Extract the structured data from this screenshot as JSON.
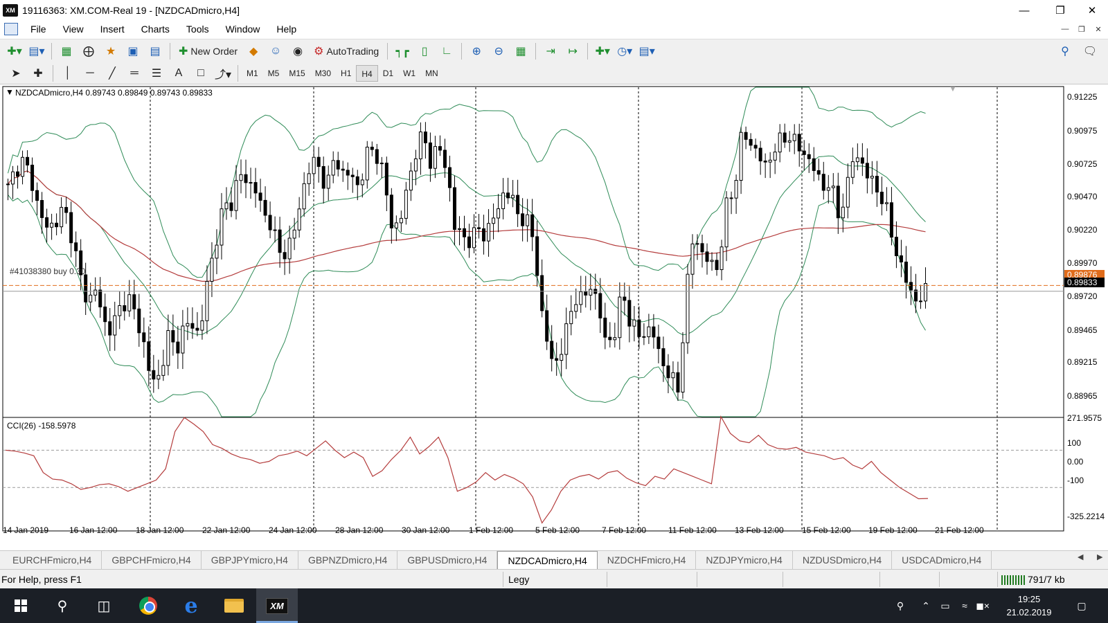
{
  "window": {
    "title": "19116363: XM.COM-Real 19 - [NZDCADmicro,H4]",
    "logo": "XM"
  },
  "menu": [
    "File",
    "View",
    "Insert",
    "Charts",
    "Tools",
    "Window",
    "Help"
  ],
  "toolbar": {
    "new_order": "New Order",
    "autotrading": "AutoTrading"
  },
  "timeframes": [
    "M1",
    "M5",
    "M15",
    "M30",
    "H1",
    "H4",
    "D1",
    "W1",
    "MN"
  ],
  "active_timeframe": "H4",
  "chart": {
    "header": "NZDCADmicro,H4  0.89743 0.89849 0.89743 0.89833",
    "order_label": "#41038380 buy 0.30",
    "current_price": "0.89833",
    "bid_price": "0.89876",
    "price_ticks": [
      "0.91225",
      "0.90975",
      "0.90725",
      "0.90470",
      "0.90220",
      "0.89970",
      "0.89720",
      "0.89465",
      "0.89215",
      "0.88965"
    ],
    "cci_label": "CCI(26) -158.5978",
    "cci_ticks": [
      "271.9575",
      "100",
      "0.00",
      "-100",
      "-325.2214"
    ],
    "time_labels": [
      "14 Jan 2019",
      "16 Jan 12:00",
      "18 Jan 12:00",
      "22 Jan 12:00",
      "24 Jan 12:00",
      "28 Jan 12:00",
      "30 Jan 12:00",
      "1 Feb 12:00",
      "5 Feb 12:00",
      "7 Feb 12:00",
      "11 Feb 12:00",
      "13 Feb 12:00",
      "15 Feb 12:00",
      "19 Feb 12:00",
      "21 Feb 12:00"
    ]
  },
  "chart_data": {
    "type": "candlestick",
    "symbol": "NZDCADmicro",
    "timeframe": "H4",
    "ylim": [
      0.889,
      0.9135
    ],
    "order_level": 0.89876,
    "current_level": 0.89833,
    "close_path": [
      0.906,
      0.9075,
      0.908,
      0.9065,
      0.904,
      0.903,
      0.9035,
      0.9045,
      0.9025,
      0.8995,
      0.8975,
      0.8985,
      0.896,
      0.8955,
      0.897,
      0.898,
      0.8965,
      0.8945,
      0.8915,
      0.892,
      0.895,
      0.894,
      0.8955,
      0.896,
      0.895,
      0.899,
      0.902,
      0.9045,
      0.905,
      0.907,
      0.9065,
      0.906,
      0.904,
      0.9035,
      0.901,
      0.9015,
      0.903,
      0.906,
      0.908,
      0.9075,
      0.906,
      0.9085,
      0.907,
      0.907,
      0.906,
      0.9085,
      0.909,
      0.907,
      0.9035,
      0.903,
      0.906,
      0.9085,
      0.91,
      0.908,
      0.909,
      0.9075,
      0.903,
      0.9025,
      0.902,
      0.903,
      0.9025,
      0.904,
      0.9055,
      0.9055,
      0.904,
      0.9035,
      0.902,
      0.896,
      0.8935,
      0.893,
      0.8955,
      0.898,
      0.8975,
      0.899,
      0.897,
      0.8945,
      0.895,
      0.8985,
      0.896,
      0.895,
      0.8955,
      0.895,
      0.893,
      0.892,
      0.891,
      0.898,
      0.903,
      0.901,
      0.9005,
      0.9,
      0.9045,
      0.906,
      0.91,
      0.9095,
      0.9085,
      0.9075,
      0.909,
      0.9095,
      0.91,
      0.909,
      0.9085,
      0.9075,
      0.906,
      0.9065,
      0.904,
      0.9055,
      0.9085,
      0.908,
      0.9065,
      0.906,
      0.9045,
      0.902,
      0.9,
      0.8985,
      0.8975,
      0.8983
    ],
    "indicators": {
      "bollinger_bands": true,
      "moving_average_color": "#b43c3c",
      "cci_period": 26,
      "cci_last": -158.5978,
      "cci_path": [
        100,
        95,
        85,
        70,
        -20,
        -55,
        -60,
        -80,
        -110,
        -100,
        -85,
        -80,
        -95,
        -120,
        -100,
        -80,
        -60,
        0,
        200,
        275,
        240,
        200,
        130,
        110,
        80,
        60,
        50,
        30,
        40,
        70,
        80,
        95,
        70,
        110,
        150,
        100,
        60,
        90,
        60,
        -40,
        -10,
        50,
        100,
        170,
        80,
        120,
        170,
        60,
        -120,
        -100,
        -70,
        -20,
        -60,
        -30,
        -50,
        -80,
        -150,
        -290,
        -220,
        -120,
        -60,
        -40,
        -30,
        -55,
        -20,
        -10,
        -50,
        -75,
        -90,
        -40,
        -55,
        0,
        -20,
        -40,
        -60,
        -80,
        280,
        190,
        150,
        140,
        180,
        130,
        110,
        105,
        115,
        90,
        80,
        70,
        50,
        60,
        20,
        0,
        40,
        -20,
        -60,
        -100,
        -130,
        -160,
        -158.6
      ]
    }
  },
  "tabs": [
    "EURCHFmicro,H4",
    "GBPCHFmicro,H4",
    "GBPJPYmicro,H4",
    "GBPNZDmicro,H4",
    "GBPUSDmicro,H4",
    "NZDCADmicro,H4",
    "NZDCHFmicro,H4",
    "NZDJPYmicro,H4",
    "NZDUSDmicro,H4",
    "USDCADmicro,H4"
  ],
  "active_tab": "NZDCADmicro,H4",
  "status": {
    "help": "For Help, press F1",
    "profile": "Legy",
    "traffic": "791/7 kb"
  },
  "taskbar": {
    "time": "19:25",
    "date": "21.02.2019"
  },
  "colors": {
    "bullish": "#ffffff",
    "bearish": "#000000",
    "bands": "#2e8b57",
    "ma": "#b43c3c",
    "cci": "#b43c3c",
    "order_line": "#e06c1b"
  }
}
